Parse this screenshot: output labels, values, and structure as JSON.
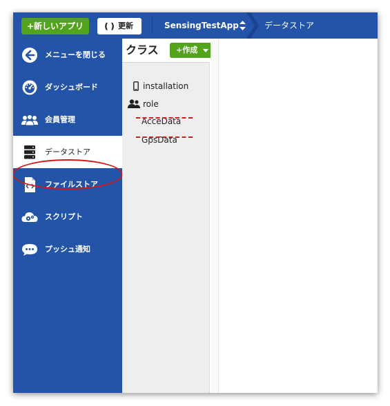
{
  "topbar": {
    "new_app_label": "+新しいアプリ",
    "refresh_label": "更新",
    "app_name": "SensingTestApp",
    "breadcrumb_current": "データストア"
  },
  "sidebar": {
    "items": [
      {
        "label": "メニューを閉じる",
        "icon": "arrow-left-circle-icon"
      },
      {
        "label": "ダッシュボード",
        "icon": "speedometer-icon"
      },
      {
        "label": "会員管理",
        "icon": "users-icon"
      },
      {
        "label": "データストア",
        "icon": "database-icon",
        "active": true
      },
      {
        "label": "ファイルストア",
        "icon": "code-file-icon"
      },
      {
        "label": "スクリプト",
        "icon": "cloud-gear-icon"
      },
      {
        "label": "プッシュ通知",
        "icon": "chat-bubble-icon"
      }
    ]
  },
  "class_panel": {
    "title": "クラス",
    "create_label": "+作成",
    "items": [
      {
        "label": "installation",
        "icon": "phone-icon"
      },
      {
        "label": "role",
        "icon": "users-icon"
      },
      {
        "label": "AcceData"
      },
      {
        "label": "GpsData"
      }
    ]
  },
  "colors": {
    "primary_blue": "#2354a8",
    "button_green": "#52a41c",
    "annotation_red": "#d51818"
  }
}
